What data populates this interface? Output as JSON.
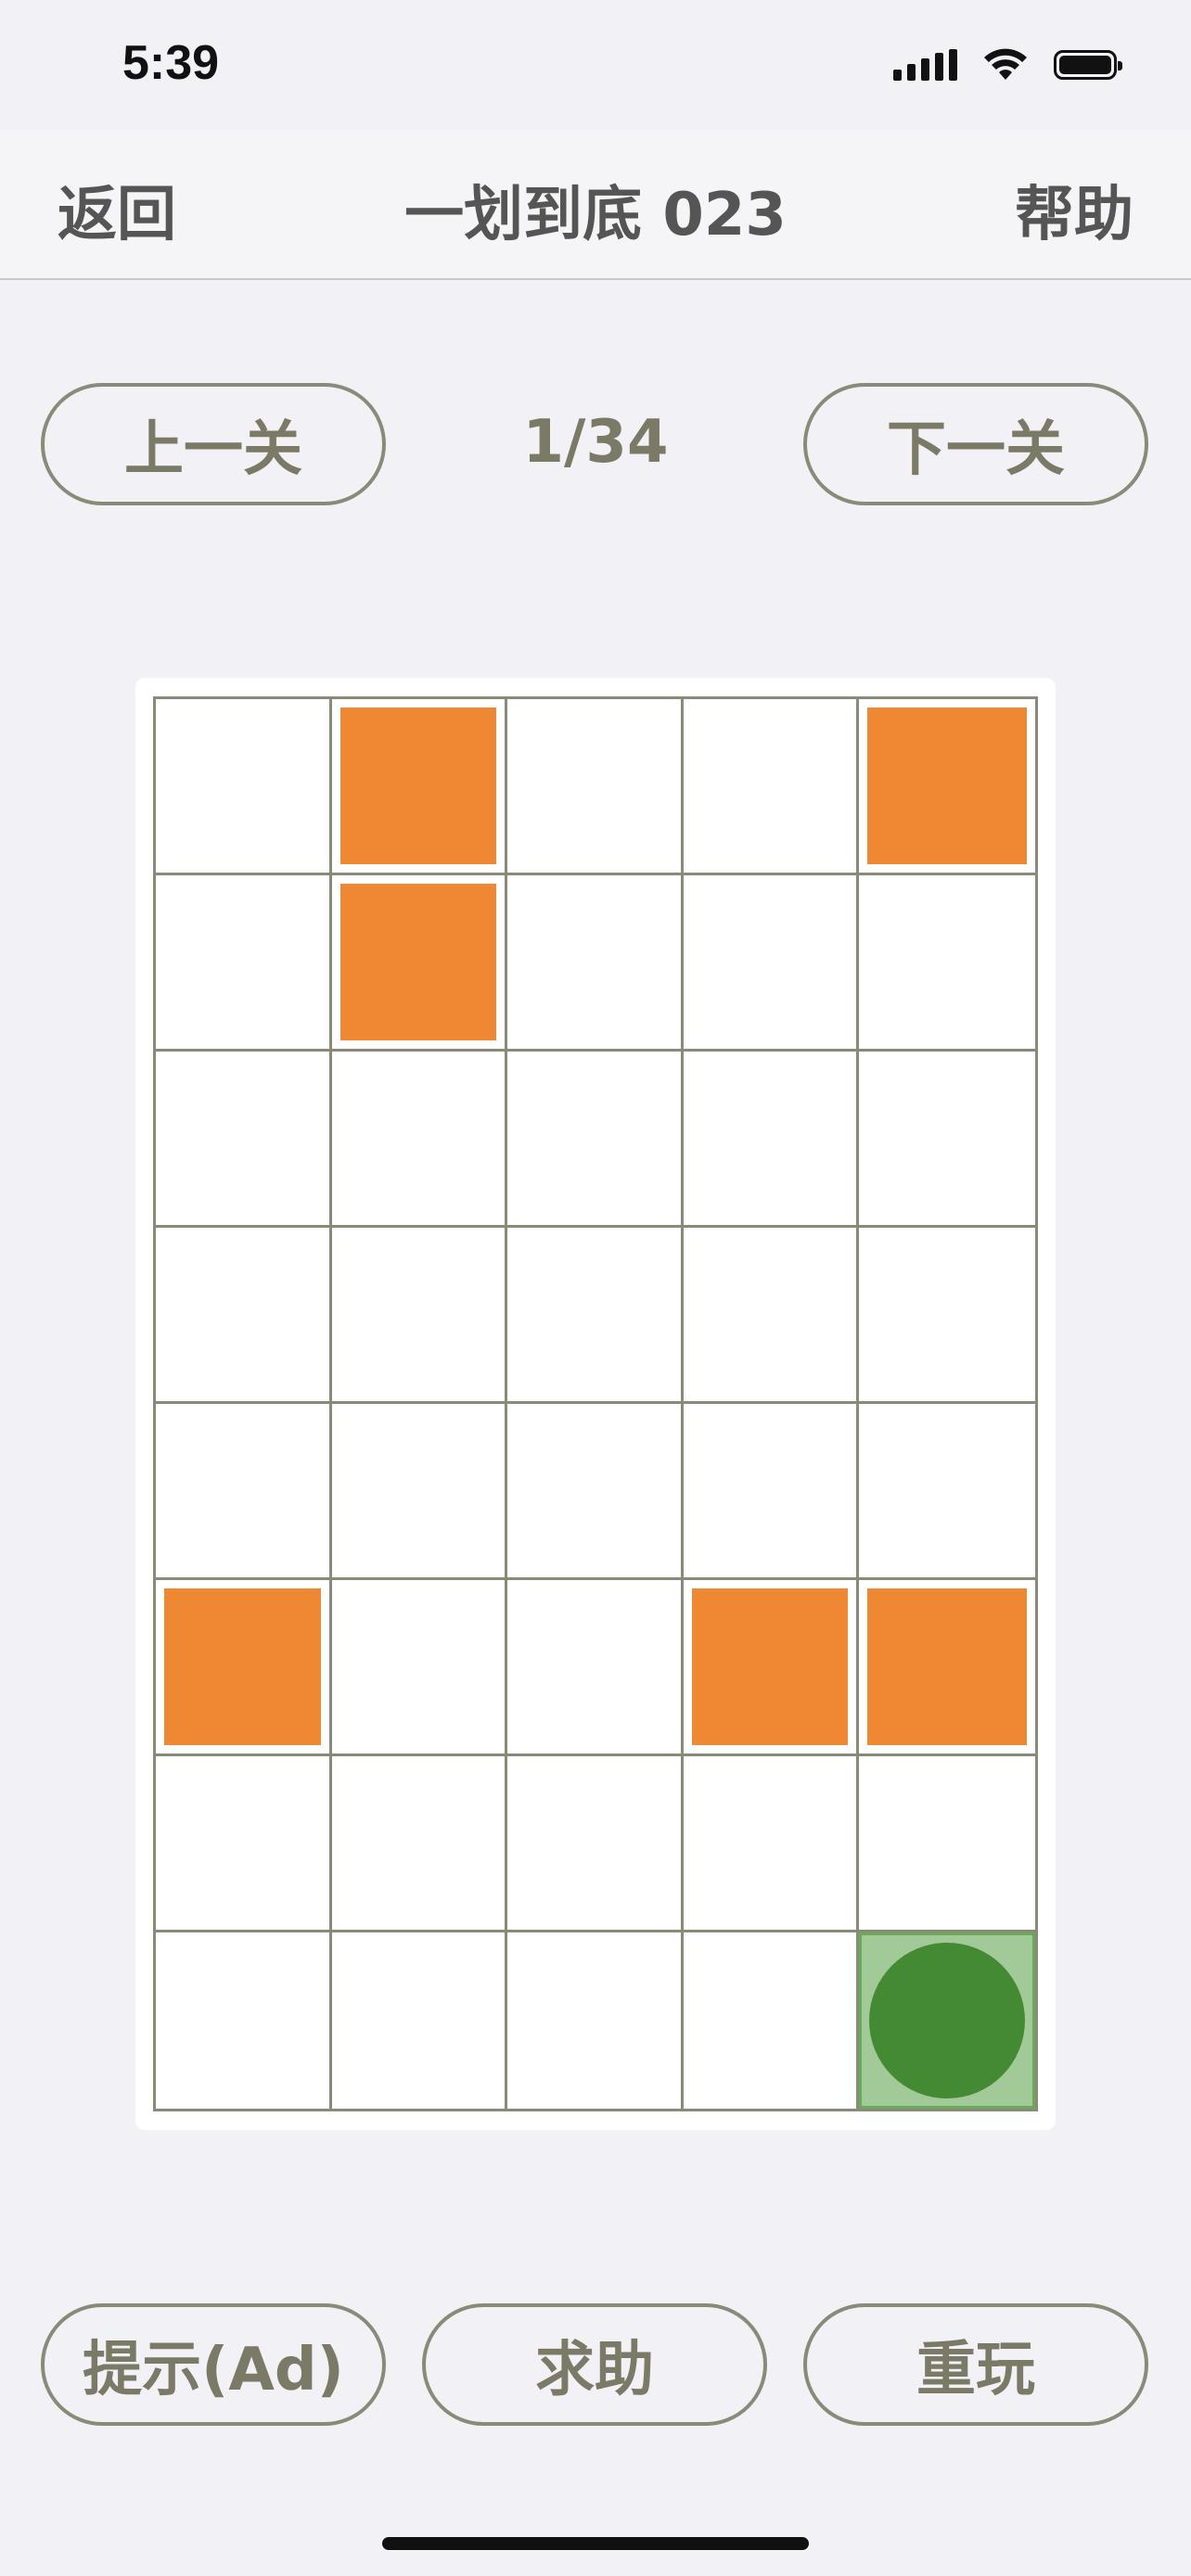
{
  "status_bar": {
    "time": "5:39",
    "icons": [
      "signal-icon",
      "wifi-icon",
      "battery-icon"
    ]
  },
  "nav": {
    "back_label": "返回",
    "title": "一划到底 023",
    "help_label": "帮助"
  },
  "level": {
    "prev_label": "上一关",
    "counter": "1/34",
    "next_label": "下一关"
  },
  "board": {
    "rows": 8,
    "cols": 5,
    "walls": [
      [
        0,
        1
      ],
      [
        0,
        4
      ],
      [
        1,
        1
      ],
      [
        5,
        0
      ],
      [
        5,
        3
      ],
      [
        5,
        4
      ]
    ],
    "start": [
      7,
      4
    ]
  },
  "actions": {
    "hint_label": "提示(Ad)",
    "ask_label": "求助",
    "replay_label": "重玩"
  },
  "colors": {
    "wall": "#ef8833",
    "player": "#448a33",
    "start_bg": "#a2c998",
    "start_border": "#6aa85a",
    "grid_line": "#8a8a78",
    "button_text": "#7a7a66",
    "background": "#f1f1f6"
  }
}
